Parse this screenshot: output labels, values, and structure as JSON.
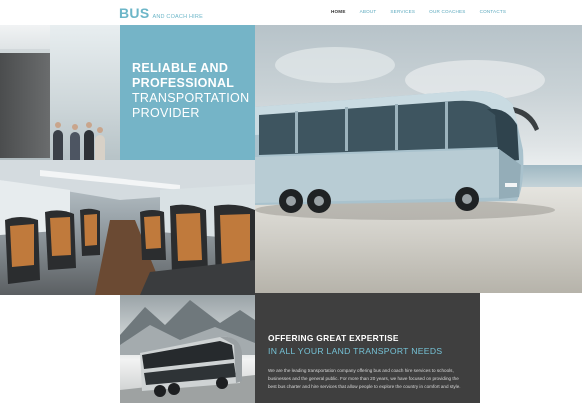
{
  "logo": {
    "main": "BUS",
    "sub": "AND COACH HIRE"
  },
  "nav": {
    "items": [
      {
        "label": "HOME",
        "active": true
      },
      {
        "label": "ABOUT",
        "active": false
      },
      {
        "label": "SERVICES",
        "active": false
      },
      {
        "label": "OUR COACHES",
        "active": false
      },
      {
        "label": "CONTACTS",
        "active": false
      }
    ]
  },
  "hero": {
    "line1": "RELIABLE AND",
    "line2": "PROFESSIONAL",
    "line3": "TRANSPORTATION",
    "line4": "PROVIDER"
  },
  "expertise": {
    "title": "OFFERING GREAT EXPERTISE",
    "subtitle": "IN ALL YOUR LAND TRANSPORT NEEDS",
    "body": "We are the leading transportation company offering bus and coach hire services to schools, businesses and the general public. For more than 20 years, we have focused on providing the best bus charter and hire services that allow people to explore the country in comfort and style."
  },
  "colors": {
    "accent": "#75b4c7",
    "dark_panel": "#3f3f3f",
    "nav_text": "#5aa8bd"
  },
  "images": {
    "office": "office-meeting-photo",
    "bus": "coach-bus-photo",
    "seats": "bus-interior-seats-photo",
    "double_decker": "double-decker-bus-photo"
  }
}
